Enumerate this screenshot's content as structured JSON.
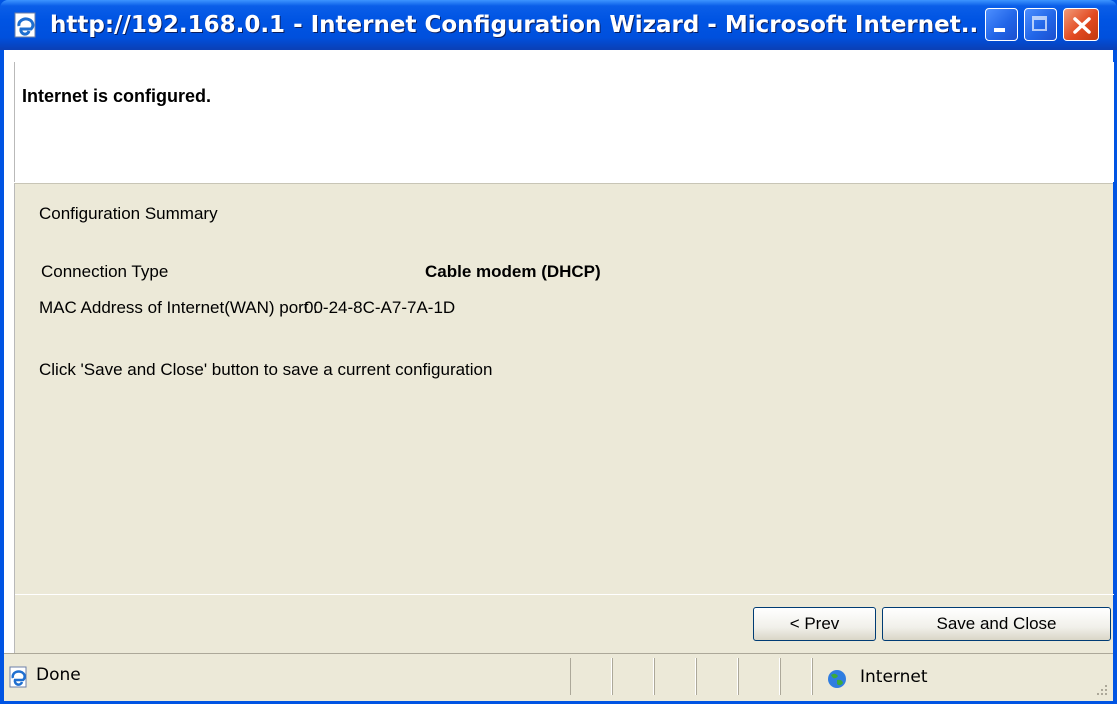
{
  "window": {
    "title": "http://192.168.0.1 - Internet Configuration Wizard - Microsoft Internet..."
  },
  "header": {
    "message": "Internet is configured."
  },
  "summary": {
    "heading": "Configuration Summary",
    "connection_type_label": "Connection Type",
    "connection_type_value": "Cable modem (DHCP)",
    "mac_label": "MAC Address of Internet(WAN) port :",
    "mac_value": "00-24-8C-A7-7A-1D",
    "instruction": "Click 'Save and Close' button to save a current configuration"
  },
  "buttons": {
    "prev_label": "< Prev",
    "save_close_label": "Save and Close"
  },
  "statusbar": {
    "status_text": "Done",
    "zone_text": "Internet"
  },
  "icons": {
    "title_icon": "ie-page-icon",
    "status_icon": "ie-page-icon",
    "zone_icon": "globe-icon"
  }
}
